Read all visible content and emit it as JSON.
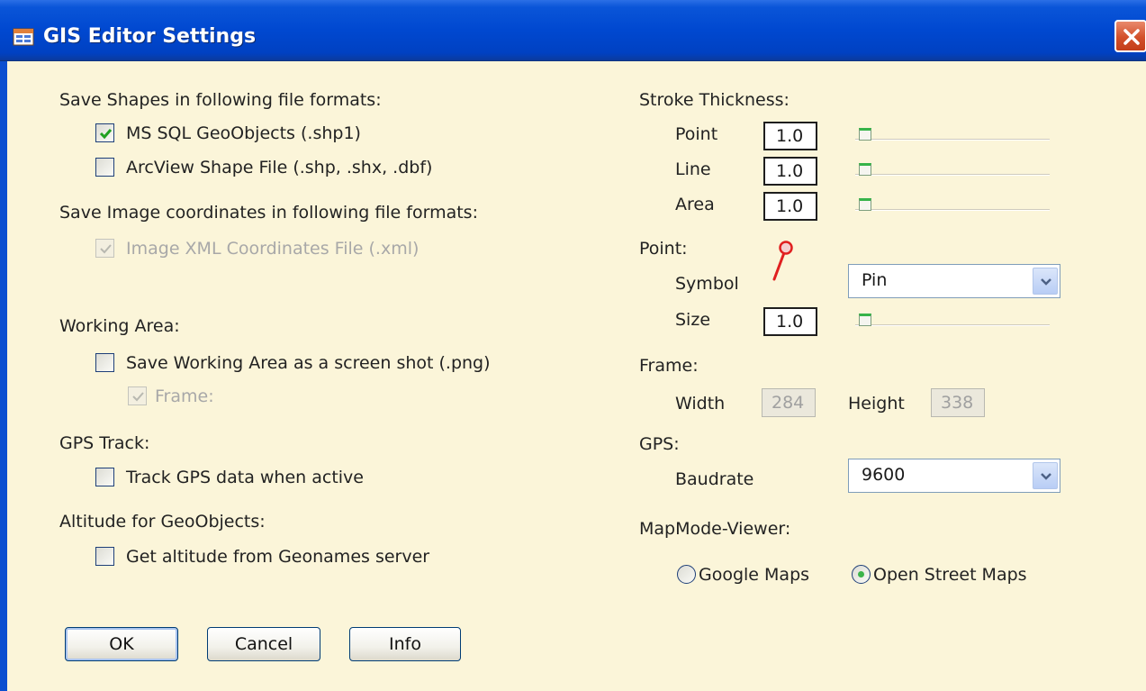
{
  "window": {
    "title": "GIS Editor Settings"
  },
  "left": {
    "save_shapes": {
      "heading": "Save Shapes in following file formats:",
      "options": [
        {
          "label": "MS SQL GeoObjects (.shp1)",
          "checked": true,
          "enabled": true
        },
        {
          "label": "ArcView Shape File (.shp, .shx, .dbf)",
          "checked": false,
          "enabled": true
        }
      ]
    },
    "save_image": {
      "heading": "Save Image coordinates in following file formats:",
      "options": [
        {
          "label": "Image XML Coordinates File (.xml)",
          "checked": true,
          "enabled": false
        }
      ]
    },
    "working_area": {
      "heading": "Working Area:",
      "options": [
        {
          "label": "Save Working Area as a screen shot (.png)",
          "checked": false,
          "enabled": true
        },
        {
          "label": "Frame:",
          "checked": true,
          "enabled": false
        }
      ]
    },
    "gps_track": {
      "heading": "GPS Track:",
      "options": [
        {
          "label": "Track GPS data when active",
          "checked": false,
          "enabled": true
        }
      ]
    },
    "altitude": {
      "heading": "Altitude for GeoObjects:",
      "options": [
        {
          "label": "Get altitude from Geonames server",
          "checked": false,
          "enabled": true
        }
      ]
    }
  },
  "right": {
    "stroke": {
      "heading": "Stroke Thickness:",
      "rows": [
        {
          "label": "Point",
          "value": "1.0"
        },
        {
          "label": "Line",
          "value": "1.0"
        },
        {
          "label": "Area",
          "value": "1.0"
        }
      ]
    },
    "point": {
      "heading": "Point:",
      "symbol_label": "Symbol",
      "symbol_value": "Pin",
      "size_label": "Size",
      "size_value": "1.0"
    },
    "frame": {
      "heading": "Frame:",
      "width_label": "Width",
      "width_value": "284",
      "height_label": "Height",
      "height_value": "338"
    },
    "gps": {
      "heading": "GPS:",
      "baudrate_label": "Baudrate",
      "baudrate_value": "9600"
    },
    "mapmode": {
      "heading": "MapMode-Viewer:",
      "options": [
        {
          "label": "Google Maps",
          "selected": false
        },
        {
          "label": "Open Street Maps",
          "selected": true
        }
      ]
    }
  },
  "buttons": {
    "ok": "OK",
    "cancel": "Cancel",
    "info": "Info"
  },
  "colors": {
    "titlebar": "#0048d0",
    "client_bg": "#fbf5d9",
    "check_green": "#21a121",
    "pin_red": "#e02020"
  }
}
